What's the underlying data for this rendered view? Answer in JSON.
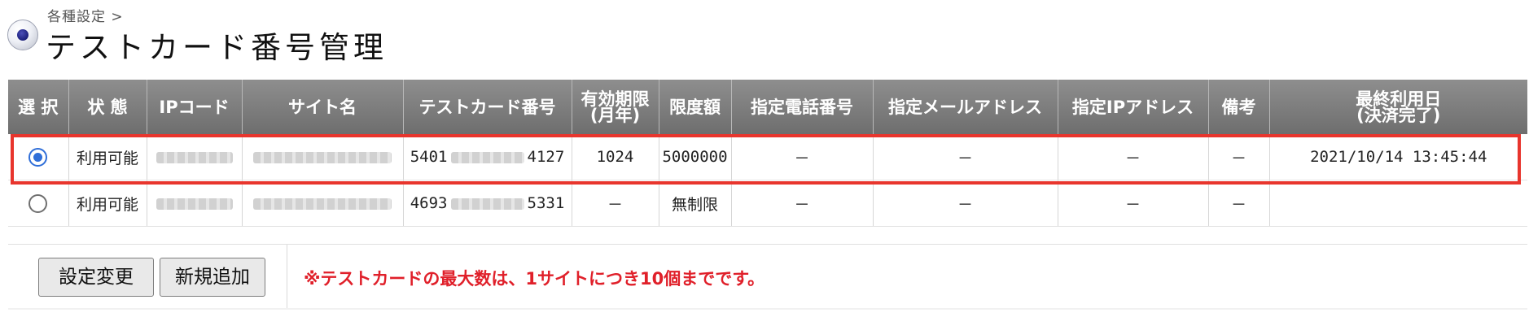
{
  "header": {
    "breadcrumb": "各種設定 >",
    "title": "テストカード番号管理"
  },
  "table": {
    "columns": [
      {
        "line1": "選 択",
        "line2": ""
      },
      {
        "line1": "状 態",
        "line2": ""
      },
      {
        "line1": "IPコード",
        "line2": ""
      },
      {
        "line1": "サイト名",
        "line2": ""
      },
      {
        "line1": "テストカード番号",
        "line2": ""
      },
      {
        "line1": "有効期限",
        "line2": "(月年)"
      },
      {
        "line1": "限度額",
        "line2": ""
      },
      {
        "line1": "指定電話番号",
        "line2": ""
      },
      {
        "line1": "指定メールアドレス",
        "line2": ""
      },
      {
        "line1": "指定IPアドレス",
        "line2": ""
      },
      {
        "line1": "備考",
        "line2": ""
      },
      {
        "line1": "最終利用日",
        "line2": "(決済完了)"
      }
    ],
    "rows": [
      {
        "selected": true,
        "status": "利用可能",
        "card_prefix": "5401",
        "card_suffix": "4127",
        "expiry": "1024",
        "limit": "5000000",
        "phone": "－",
        "email": "－",
        "ip": "－",
        "note": "－",
        "last_used": "2021/10/14 13:45:44"
      },
      {
        "selected": false,
        "status": "利用可能",
        "card_prefix": "4693",
        "card_suffix": "5331",
        "expiry": "－",
        "limit": "無制限",
        "phone": "－",
        "email": "－",
        "ip": "－",
        "note": "－",
        "last_used": ""
      }
    ]
  },
  "footer": {
    "change_button": "設定変更",
    "add_button": "新規追加",
    "notice": "※テストカードの最大数は、1サイトにつき10個までです。"
  },
  "colors": {
    "header_bg": "#7a7a7a",
    "highlight": "#e8352d",
    "notice": "#e0202a",
    "radio_selected": "#2f6ed8"
  }
}
